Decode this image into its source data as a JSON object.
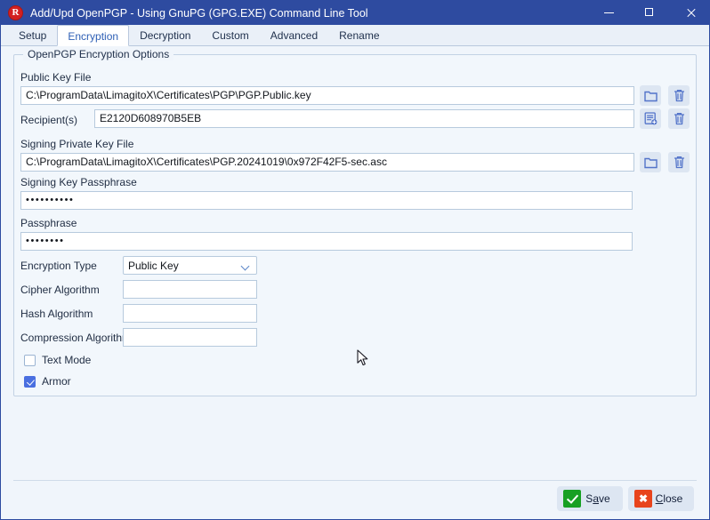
{
  "window": {
    "title": "Add/Upd OpenPGP - Using GnuPG (GPG.EXE) Command Line Tool",
    "app_icon_letter": "R",
    "minimize_label": "Minimize",
    "maximize_label": "Maximize",
    "close_label": "Close",
    "titlebar_color": "#2e4ba0"
  },
  "tabs": [
    {
      "label": "Setup",
      "active": false
    },
    {
      "label": "Encryption",
      "active": true
    },
    {
      "label": "Decryption",
      "active": false
    },
    {
      "label": "Custom",
      "active": false
    },
    {
      "label": "Advanced",
      "active": false
    },
    {
      "label": "Rename",
      "active": false
    }
  ],
  "group": {
    "legend": "OpenPGP Encryption Options"
  },
  "fields": {
    "public_key_file": {
      "label": "Public Key File",
      "value": "C:\\ProgramData\\LimagitoX\\Certificates\\PGP\\PGP.Public.key",
      "browse_icon": "folder-icon",
      "clear_icon": "trash-icon"
    },
    "recipients": {
      "label": "Recipient(s)",
      "value": "E2120D608970B5EB",
      "select_icon": "certificate-list-add-icon",
      "clear_icon": "trash-icon"
    },
    "signing_private_key_file": {
      "label": "Signing Private Key File",
      "value": "C:\\ProgramData\\LimagitoX\\Certificates\\PGP.20241019\\0x972F42F5-sec.asc",
      "browse_icon": "folder-icon",
      "clear_icon": "trash-icon"
    },
    "signing_key_passphrase": {
      "label": "Signing Key Passphrase",
      "value": "••••••••••"
    },
    "passphrase": {
      "label": "Passphrase",
      "value": "••••••••"
    },
    "encryption_type": {
      "label": "Encryption Type",
      "value": "Public Key",
      "options": [
        "Public Key"
      ]
    },
    "cipher_algorithm": {
      "label": "Cipher Algorithm",
      "value": ""
    },
    "hash_algorithm": {
      "label": "Hash Algorithm",
      "value": ""
    },
    "compression_algorithm": {
      "label": "Compression Algorithm",
      "value": ""
    },
    "text_mode": {
      "label": "Text Mode",
      "checked": false
    },
    "armor": {
      "label": "Armor",
      "checked": true
    }
  },
  "footer": {
    "save": {
      "label_pre": "S",
      "label_accel": "a",
      "label_post": "ve",
      "icon": "green-check-icon"
    },
    "close": {
      "label_pre": "",
      "label_accel": "C",
      "label_post": "lose",
      "icon": "red-x-icon"
    }
  },
  "colors": {
    "accent_blue": "#2e4ba0",
    "tab_active_text": "#2e5fb5",
    "checkbox_checked": "#4a6fe0",
    "save_green": "#17a023",
    "close_red": "#e8441c",
    "icon_blue": "#5273c9"
  }
}
